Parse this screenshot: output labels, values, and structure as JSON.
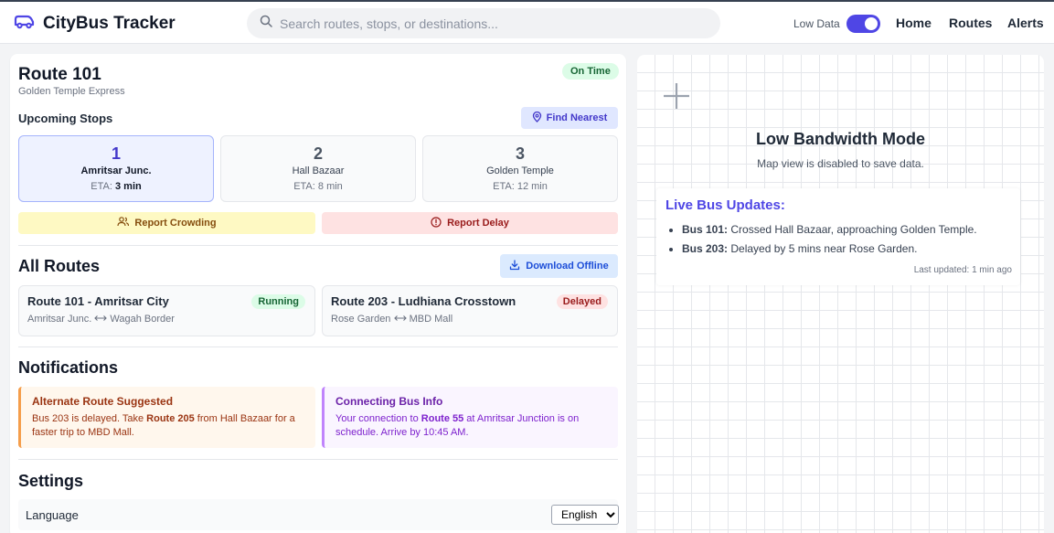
{
  "app": {
    "title": "CityBus Tracker"
  },
  "search": {
    "placeholder": "Search routes, stops, or destinations..."
  },
  "header": {
    "low_data_label": "Low Data",
    "low_data_on": true,
    "nav": [
      "Home",
      "Routes",
      "Alerts"
    ]
  },
  "route": {
    "title": "Route 101",
    "subtitle": "Golden Temple Express",
    "status": "On Time"
  },
  "upcoming": {
    "heading": "Upcoming Stops",
    "find_nearest": "Find Nearest",
    "stops": [
      {
        "num": "1",
        "name": "Amritsar Junc.",
        "eta_label": "ETA:",
        "eta": "3 min"
      },
      {
        "num": "2",
        "name": "Hall Bazaar",
        "eta_label": "ETA:",
        "eta": "8 min"
      },
      {
        "num": "3",
        "name": "Golden Temple",
        "eta_label": "ETA:",
        "eta": "12 min"
      }
    ],
    "report_crowding": "Report Crowding",
    "report_delay": "Report Delay"
  },
  "all_routes": {
    "heading": "All Routes",
    "download": "Download Offline",
    "routes": [
      {
        "name": "Route 101 - Amritsar City",
        "from": "Amritsar Junc.",
        "to": "Wagah Border",
        "status": "Running"
      },
      {
        "name": "Route 203 - Ludhiana Crosstown",
        "from": "Rose Garden",
        "to": "MBD Mall",
        "status": "Delayed"
      }
    ]
  },
  "notifications": {
    "heading": "Notifications",
    "items": [
      {
        "title": "Alternate Route Suggested",
        "pre": "Bus 203 is delayed. Take ",
        "bold": "Route 205",
        "post": " from Hall Bazaar for a faster trip to MBD Mall."
      },
      {
        "title": "Connecting Bus Info",
        "pre": "Your connection to ",
        "bold": "Route 55",
        "post": " at Amritsar Junction is on schedule. Arrive by 10:45 AM."
      }
    ]
  },
  "settings": {
    "heading": "Settings",
    "language_label": "Language",
    "language_value": "English"
  },
  "map": {
    "title": "Low Bandwidth Mode",
    "subtitle": "Map view is disabled to save data.",
    "updates_title": "Live Bus Updates:",
    "updates": [
      {
        "bus": "Bus 101:",
        "text": " Crossed Hall Bazaar, approaching Golden Temple."
      },
      {
        "bus": "Bus 203:",
        "text": " Delayed by 5 mins near Rose Garden."
      }
    ],
    "last_updated": "Last updated: 1 min ago"
  },
  "colors": {
    "accent": "#4f46e5",
    "success": "#166534",
    "danger": "#991b1b",
    "warning": "#854d0e"
  }
}
